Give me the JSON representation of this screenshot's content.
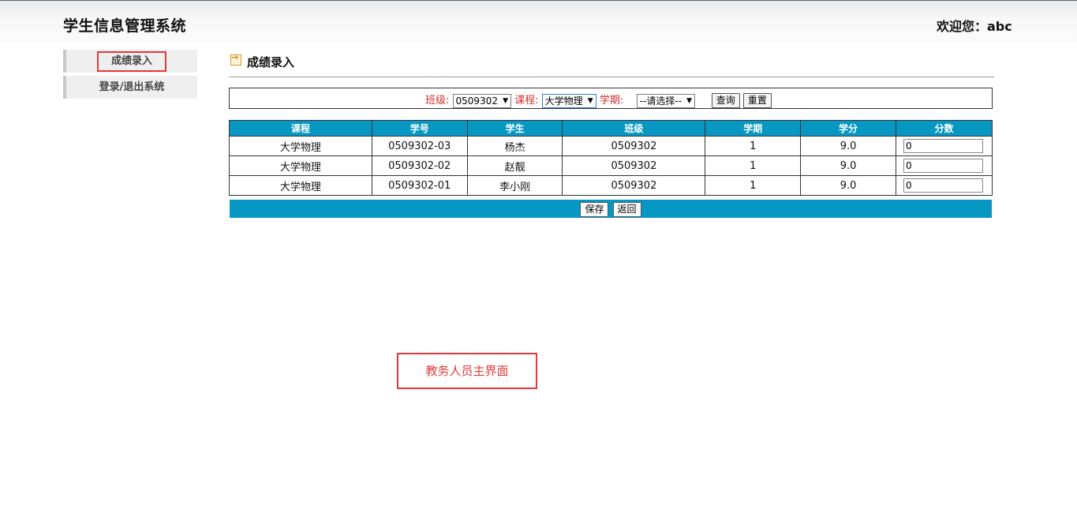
{
  "header": {
    "app_title": "学生信息管理系统",
    "welcome": "欢迎您：abc"
  },
  "sidebar": {
    "items": [
      {
        "label": "成绩录入",
        "active": true
      },
      {
        "label": "登录/退出系统",
        "active": false
      }
    ]
  },
  "main": {
    "section_title": "成绩录入",
    "filters": {
      "class_label": "班级:",
      "class_value": "0509302",
      "course_label": "课程:",
      "course_value": "大学物理",
      "term_label": "学期:",
      "term_value": "--请选择--",
      "query_button": "查询",
      "reset_button": "重置"
    },
    "table": {
      "columns": [
        "课程",
        "学号",
        "学生",
        "班级",
        "学期",
        "学分",
        "分数"
      ],
      "rows": [
        {
          "course": "大学物理",
          "student_id": "0509302-03",
          "name": "杨杰",
          "class": "0509302",
          "term": "1",
          "credit": "9.0",
          "score": "0"
        },
        {
          "course": "大学物理",
          "student_id": "0509302-02",
          "name": "赵靓",
          "class": "0509302",
          "term": "1",
          "credit": "9.0",
          "score": "0"
        },
        {
          "course": "大学物理",
          "student_id": "0509302-01",
          "name": "李小刚",
          "class": "0509302",
          "term": "1",
          "credit": "9.0",
          "score": "0"
        }
      ]
    },
    "save_button": "保存",
    "back_button": "返回"
  },
  "annotation": {
    "label": "教务人员主界面"
  },
  "colors": {
    "table_header": "#0797c3",
    "highlight": "#e23a3a",
    "filter_label": "#d03030"
  }
}
